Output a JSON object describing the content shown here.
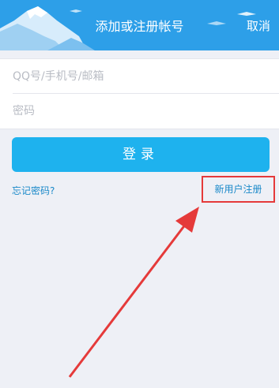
{
  "header": {
    "title": "添加或注册帐号",
    "cancel_label": "取消"
  },
  "form": {
    "account_placeholder": "QQ号/手机号/邮箱",
    "password_placeholder": "密码"
  },
  "actions": {
    "login_label": "登录",
    "forgot_label": "忘记密码?",
    "register_label": "新用户注册"
  },
  "colors": {
    "header": "#2d9fe8",
    "button": "#1eb2ee",
    "link": "#1a89c9",
    "highlight": "#e53a3a",
    "background": "#eef0f6"
  },
  "annotation": {
    "highlight_box": "red-rectangle",
    "pointer": "red-arrow"
  }
}
